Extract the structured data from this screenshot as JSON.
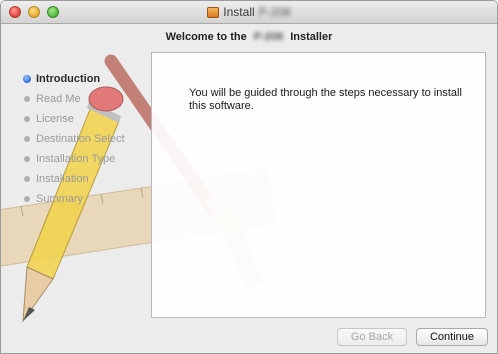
{
  "window": {
    "title_prefix": "Install",
    "title_blurred": "P-208",
    "installer_welcome_prefix": "Welcome to the",
    "installer_welcome_blurred": "P-208",
    "installer_welcome_suffix": "Installer"
  },
  "sidebar": {
    "items": [
      {
        "label": "Introduction",
        "active": true
      },
      {
        "label": "Read Me",
        "active": false
      },
      {
        "label": "License",
        "active": false
      },
      {
        "label": "Destination Select",
        "active": false
      },
      {
        "label": "Installation Type",
        "active": false
      },
      {
        "label": "Installation",
        "active": false
      },
      {
        "label": "Summary",
        "active": false
      }
    ]
  },
  "main": {
    "message": "You will be guided through the steps necessary to install this software."
  },
  "buttons": {
    "back_label": "Go Back",
    "continue_label": "Continue"
  }
}
